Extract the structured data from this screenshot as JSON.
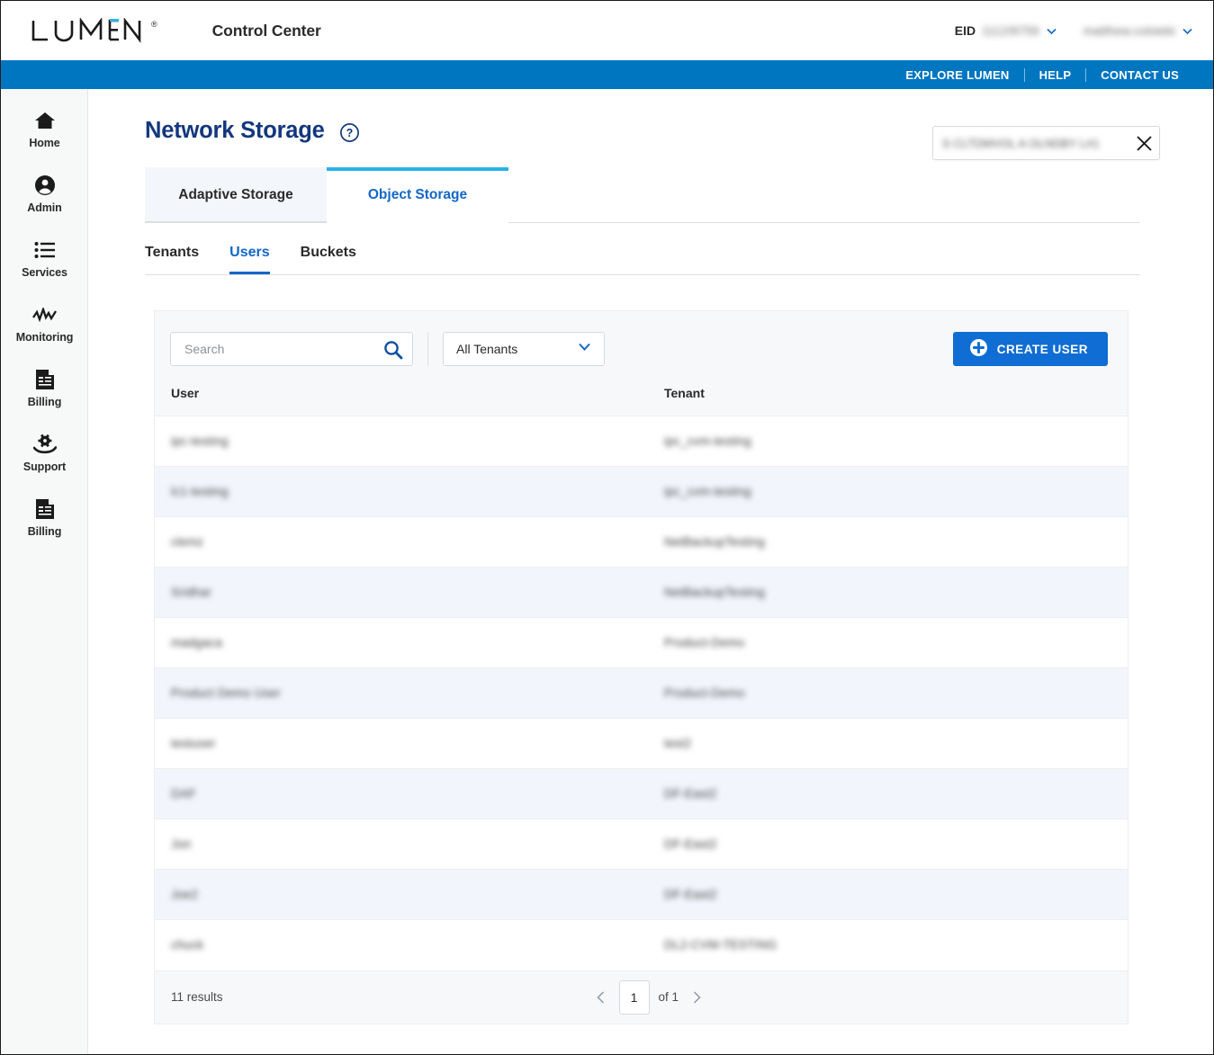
{
  "header": {
    "brand": "LUMEN",
    "brand_registered": "®",
    "app_title": "Control Center",
    "eid_label": "EID",
    "eid_value": "1112/8759",
    "user_name": "matthew.colsteki",
    "nav_links": [
      {
        "label": "EXPLORE LUMEN"
      },
      {
        "label": "HELP"
      },
      {
        "label": "CONTACT US"
      }
    ]
  },
  "sidebar": {
    "items": [
      {
        "label": "Home",
        "icon": "home-icon"
      },
      {
        "label": "Admin",
        "icon": "user-circle-icon"
      },
      {
        "label": "Services",
        "icon": "list-icon"
      },
      {
        "label": "Monitoring",
        "icon": "waveform-icon"
      },
      {
        "label": "Billing",
        "icon": "invoice-icon"
      },
      {
        "label": "Support",
        "icon": "hand-gear-icon"
      },
      {
        "label": "Billing",
        "icon": "invoice-icon"
      }
    ]
  },
  "page": {
    "title": "Network Storage",
    "help_icon": "question-circle-icon",
    "account_chip": {
      "text": "S CLTDMVOL A OLNDBY L#1",
      "close_icon": "close-icon"
    },
    "tabs": [
      {
        "label": "Adaptive Storage",
        "active": false
      },
      {
        "label": "Object Storage",
        "active": true
      }
    ],
    "subtabs": [
      {
        "label": "Tenants",
        "active": false
      },
      {
        "label": "Users",
        "active": true
      },
      {
        "label": "Buckets",
        "active": false
      }
    ]
  },
  "toolbar": {
    "search_placeholder": "Search",
    "search_value": "",
    "search_icon": "search-icon",
    "tenant_filter_value": "All Tenants",
    "tenant_filter_icon": "chevron-down-icon",
    "create_button_label": "CREATE USER",
    "create_button_icon": "plus-circle-icon",
    "accent_color": "#0f6dd3"
  },
  "table": {
    "columns": [
      "User",
      "Tenant"
    ],
    "rows": [
      {
        "user": "ipc-testing",
        "tenant": "ipc_cvm-testing"
      },
      {
        "user": "lc1-testing",
        "tenant": "ipc_cvm-testing"
      },
      {
        "user": "clemz",
        "tenant": "NetBackupTesting"
      },
      {
        "user": "Sridhar",
        "tenant": "NetBackupTesting"
      },
      {
        "user": "madgaca",
        "tenant": "Product-Demo"
      },
      {
        "user": "Product Demo User",
        "tenant": "Product-Demo"
      },
      {
        "user": "testuser",
        "tenant": "test2"
      },
      {
        "user": "DAF",
        "tenant": "DF-East2"
      },
      {
        "user": "Jon",
        "tenant": "DF-East2"
      },
      {
        "user": "Joe2",
        "tenant": "DF-East2"
      },
      {
        "user": "chuck",
        "tenant": "DL2-CVM-TESTING"
      }
    ]
  },
  "pagination": {
    "results_text": "11 results",
    "page_value": "1",
    "of_text": "of 1",
    "prev_icon": "chevron-left-icon",
    "next_icon": "chevron-right-icon"
  },
  "colors": {
    "lumen_blue": "#0076c0",
    "accent_cyan": "#29b4e8",
    "title_navy": "#13377e",
    "link_blue": "#1267c8"
  }
}
